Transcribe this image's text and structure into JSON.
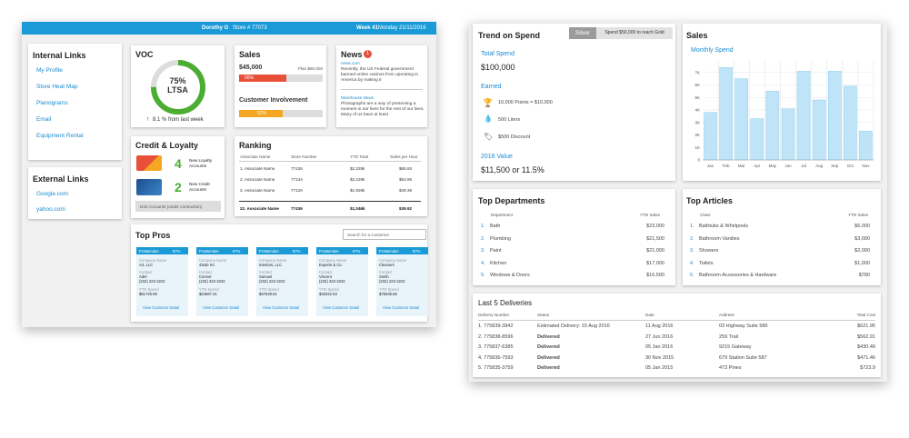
{
  "header": {
    "user": "Dorothy G",
    "store": "Store # 77073",
    "week": "Week 41",
    "date": "Monday 21/11/2016"
  },
  "internal_links": {
    "title": "Internal Links",
    "items": [
      "My Profile",
      "Store Heat Map",
      "Planograms",
      "Email",
      "Equipment Rental"
    ]
  },
  "external_links": {
    "title": "External Links",
    "items": [
      "Google.com",
      "yahoo.com"
    ]
  },
  "voc": {
    "title": "VOC",
    "percent": "75%",
    "label": "LTSA",
    "fraction": 0.75,
    "trend": "8.1 % from last week"
  },
  "sales_card": {
    "title": "Sales",
    "amount": "$45,000",
    "plan": "Plan $80,000",
    "bar_label": "56%",
    "bar_fraction": 0.56,
    "involvement_title": "Customer Involvement",
    "inv_label": "52%",
    "inv_fraction": 0.52
  },
  "news": {
    "title": "News",
    "badge": "1",
    "source1": "news.com",
    "text1": "Recently, the US Federal government banned online casinos from operating in America by making it",
    "source2": "Warehouse News",
    "text2": "Photographs are a way of preserving a moment in our lives for the rest of our lives. Many of us have at least"
  },
  "credit": {
    "title": "Credit & Loyalty",
    "loyalty_count": "4",
    "loyalty_label1": "New Loyalty",
    "loyalty_label2": "Accounts",
    "credit_count": "2",
    "credit_label1": "New Credit",
    "credit_label2": "Accounts",
    "footer": "D42 Accounts (under contruction)"
  },
  "ranking": {
    "title": "Ranking",
    "headers": [
      "Associate Name",
      "Store Number",
      "YTD Total",
      "Sales per Hour"
    ],
    "rows": [
      [
        "1. Associate Name",
        "77436",
        "$2,329k",
        "$65.93"
      ],
      [
        "2. Associate Name",
        "77134",
        "$2,229k",
        "$63.95"
      ],
      [
        "3. Associate Name",
        "77129",
        "$1,929k",
        "$49.39"
      ]
    ],
    "me": [
      "22. Associate Name",
      "77436",
      "$1,046k",
      "$39.92"
    ]
  },
  "top_pros": {
    "title": "Top Pros",
    "search_placeholder": "Search for a Customer",
    "pros": [
      {
        "badge": "ProMember",
        "pct": "87%",
        "company_label": "Company Name",
        "company": "A3, LLC",
        "contact_label": "Contact",
        "contact": "Adel",
        "phone": "(222) 222-2222",
        "ytd_label": "YTD Spend",
        "ytd": "$61725.98",
        "link": "View Customer Detail"
      },
      {
        "badge": "ProMember",
        "pct": "87%",
        "company_label": "Company Name",
        "company": "4Sale Inc",
        "contact_label": "Contact",
        "contact": "Connor",
        "phone": "(222) 222-2222",
        "ytd_label": "YTD Spend",
        "ytd": "$24667.31",
        "link": "View Customer Detail"
      },
      {
        "badge": "ProMember",
        "pct": "87%",
        "company_label": "Company Name",
        "company": "Interiors, LLC",
        "contact_label": "Contact",
        "contact": "Samuel",
        "phone": "(222) 222-2222",
        "ytd_label": "YTD Spend",
        "ytd": "$47549.61",
        "link": "View Customer Detail"
      },
      {
        "badge": "ProMember",
        "pct": "87%",
        "company_label": "Company Name",
        "company": "Experts & Co",
        "contact_label": "Contact",
        "contact": "Vincent",
        "phone": "(222) 222-2222",
        "ytd_label": "YTD Spend",
        "ytd": "$33342.53",
        "link": "View Customer Detail"
      },
      {
        "badge": "ProMember",
        "pct": "87%",
        "company_label": "Company Name",
        "company": "Cleaners",
        "contact_label": "Contact",
        "contact": "Smith",
        "phone": "(222) 222-2222",
        "ytd_label": "YTD Spend",
        "ytd": "$75035.66",
        "link": "View Customer Detail"
      }
    ]
  },
  "trend": {
    "title": "Trend on Spend",
    "tier": "Silver",
    "tier_msg": "Spend $50,000 to reach Gold",
    "total_label": "Total Spend",
    "total": "$100,000",
    "earned_label": "Earned",
    "earned": [
      {
        "icon": "trophy-icon",
        "text": "10,000 Points = $10,000"
      },
      {
        "icon": "drop-icon",
        "text": "500 Liters"
      },
      {
        "icon": "tag-icon",
        "text": "$500 Discount"
      }
    ],
    "value_label": "2016 Value",
    "value": "$11,500 or 11.5%"
  },
  "sales_chart": {
    "title": "Sales",
    "subtitle": "Monthly Spend"
  },
  "chart_data": {
    "type": "bar",
    "categories": [
      "Jan",
      "Feb",
      "Mar",
      "Apr",
      "May",
      "Jun",
      "Jul",
      "Aug",
      "Sep",
      "Oct",
      "Nov"
    ],
    "values": [
      3.8,
      7.4,
      6.5,
      3.3,
      5.5,
      4.1,
      7.1,
      4.8,
      7.1,
      5.9,
      2.3
    ],
    "yticks": [
      "0",
      "1K",
      "2K",
      "3K",
      "4K",
      "5K",
      "6K",
      "7K"
    ],
    "ylim": [
      0,
      8
    ],
    "color": "#bfe3f7",
    "border": "#8ccff0"
  },
  "departments": {
    "title": "Top Departments",
    "col1": "Department",
    "col2": "YTD Sales",
    "rows": [
      [
        "1.",
        "Bath",
        "$23,000"
      ],
      [
        "2.",
        "Plumbing",
        "$21,500"
      ],
      [
        "3.",
        "Paint",
        "$21,000"
      ],
      [
        "4.",
        "Kitchen",
        "$17,000"
      ],
      [
        "5.",
        "Windows & Doors",
        "$16,500"
      ]
    ]
  },
  "articles": {
    "title": "Top Articles",
    "col1": "Class",
    "col2": "YTD Sales",
    "rows": [
      [
        "1.",
        "Bathtubs & Whirlpools",
        "$6,000"
      ],
      [
        "2.",
        "Bathroom Vanities",
        "$3,000"
      ],
      [
        "3.",
        "Showers",
        "$2,000"
      ],
      [
        "4.",
        "Toilets",
        "$1,000"
      ],
      [
        "5.",
        "Bathroom Accessories & Hardware",
        "$780"
      ]
    ]
  },
  "deliveries": {
    "title": "Last 5 Deliveries",
    "headers": [
      "Delivery Number",
      "Status",
      "Date",
      "Address",
      "Total Cost"
    ],
    "rows": [
      [
        "1. 775839-3842",
        "Estimated Delivery: 15 Aug 2016",
        "11 Aug 2016",
        "03 Highway Suite 586",
        "$621.95"
      ],
      [
        "2. 775838-8596",
        "Delivered",
        "27 Jun 2016",
        "259 Trail",
        "$562.91"
      ],
      [
        "3. 775837-6385",
        "Delivered",
        "05 Jan 2016",
        "9215 Gateway",
        "$430.49"
      ],
      [
        "4. 775836-7593",
        "Delivered",
        "30 Nov 2015",
        "679 Station Suite 587",
        "$471.46"
      ],
      [
        "5. 775835-3759",
        "Delivered",
        "05 Jan 2015",
        "473 Pines",
        "$723.9"
      ]
    ]
  },
  "colors": {
    "accent": "#1a9bd7",
    "green": "#4cad33",
    "red": "#e8503a",
    "orange": "#f5a623"
  }
}
